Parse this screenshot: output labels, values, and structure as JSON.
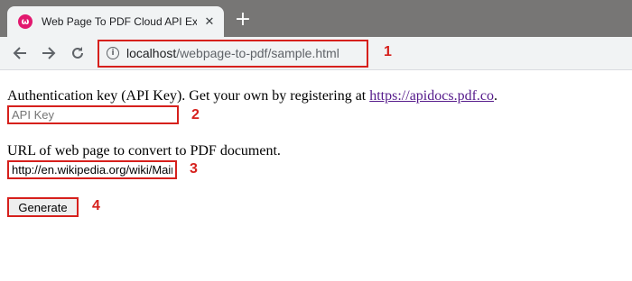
{
  "tab": {
    "title": "Web Page To PDF Cloud API Example",
    "close_glyph": "✕",
    "favicon_letter": "ω",
    "new_tab_glyph": "+"
  },
  "toolbar": {
    "url_host": "localhost",
    "url_path": "/webpage-to-pdf/sample.html",
    "info_glyph": "i"
  },
  "form": {
    "auth_label": "Authentication key (API Key). Get your own by registering at ",
    "auth_link": "https://apidocs.pdf.co",
    "auth_suffix": ".",
    "api_key_placeholder": "API Key",
    "url_label": "URL of web page to convert to PDF document.",
    "url_value": "http://en.wikipedia.org/wiki/Main_Page",
    "generate_label": "Generate"
  },
  "callouts": [
    "1",
    "2",
    "3",
    "4"
  ],
  "colors": {
    "callout_red": "#d6201c",
    "link_purple": "#551a8b",
    "tabstrip": "#777675"
  }
}
